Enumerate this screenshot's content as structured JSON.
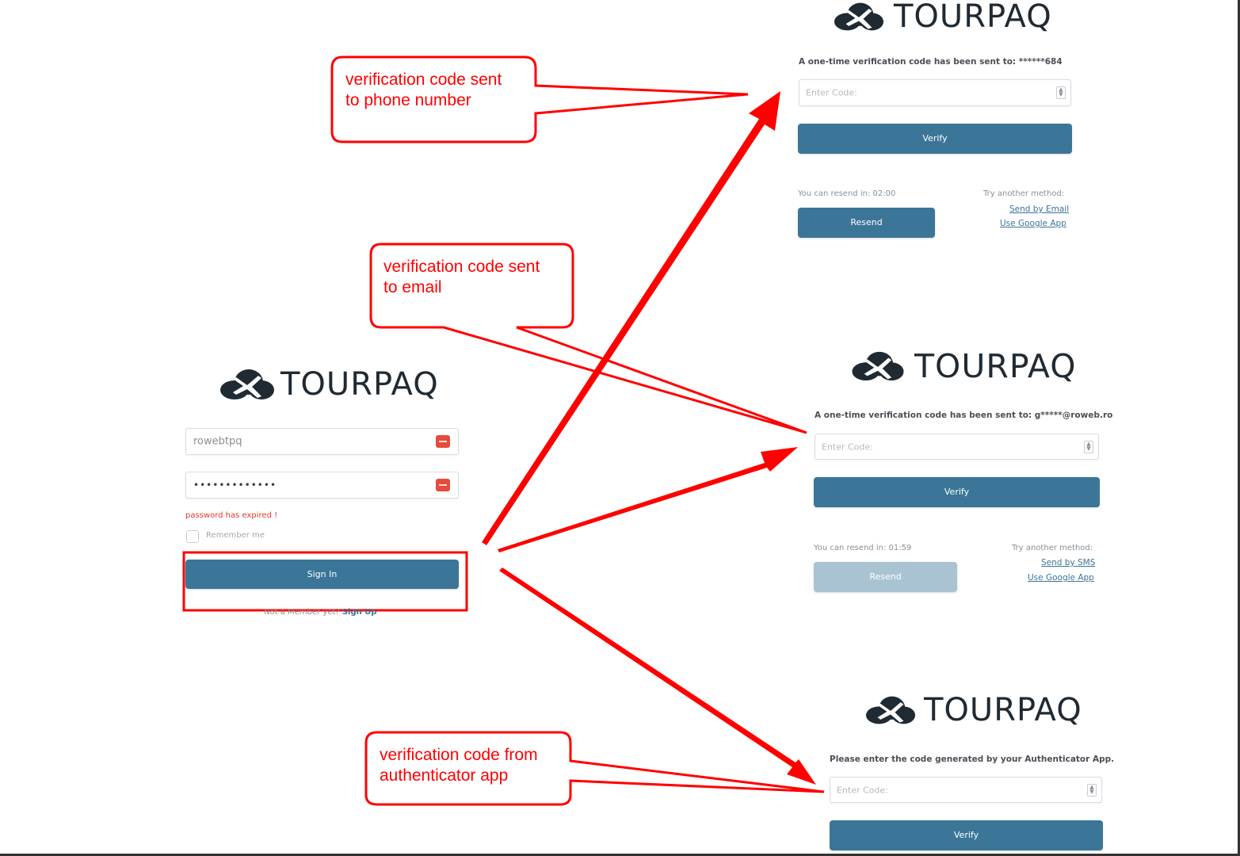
{
  "brand": {
    "name": "TOURPAQ",
    "cloud_icon": "cloud-plane-icon"
  },
  "login": {
    "username_value": "rowebtpq",
    "password_value": "•••••••••••••",
    "error_text": "password has expired !",
    "remember_label": "Remember me",
    "sign_in_label": "Sign In",
    "signup_prefix": "Not a Member yet?",
    "signup_link": "Sign Up"
  },
  "phone_panel": {
    "message": "A one-time verification code has been sent to: ******684",
    "code_placeholder": "Enter Code:",
    "verify_label": "Verify",
    "resend_timer": "You can resend in: 02:00",
    "resend_label": "Resend",
    "try_another": "Try another method:",
    "link_1": "Send by Email",
    "link_2": "Use Google App"
  },
  "email_panel": {
    "message": "A one-time verification code has been sent to: g*****@roweb.ro",
    "code_placeholder": "Enter Code:",
    "verify_label": "Verify",
    "resend_timer": "You can resend in: 01:59",
    "resend_label": "Resend",
    "try_another": "Try another method:",
    "link_1": "Send by SMS",
    "link_2": "Use Google App"
  },
  "app_panel": {
    "message": "Please enter the code generated by your Authenticator App.",
    "code_placeholder": "Enter Code:",
    "verify_label": "Verify"
  },
  "callouts": {
    "phone_line_1": "verification code sent",
    "phone_line_2": "to phone number",
    "email_line_1": "verification code sent",
    "email_line_2": "to email",
    "app_line_1": "verification code from",
    "app_line_2": "authenticator app"
  },
  "colors": {
    "accent": "#3b7598",
    "annotation": "#ff0000",
    "error": "#e5392f"
  }
}
